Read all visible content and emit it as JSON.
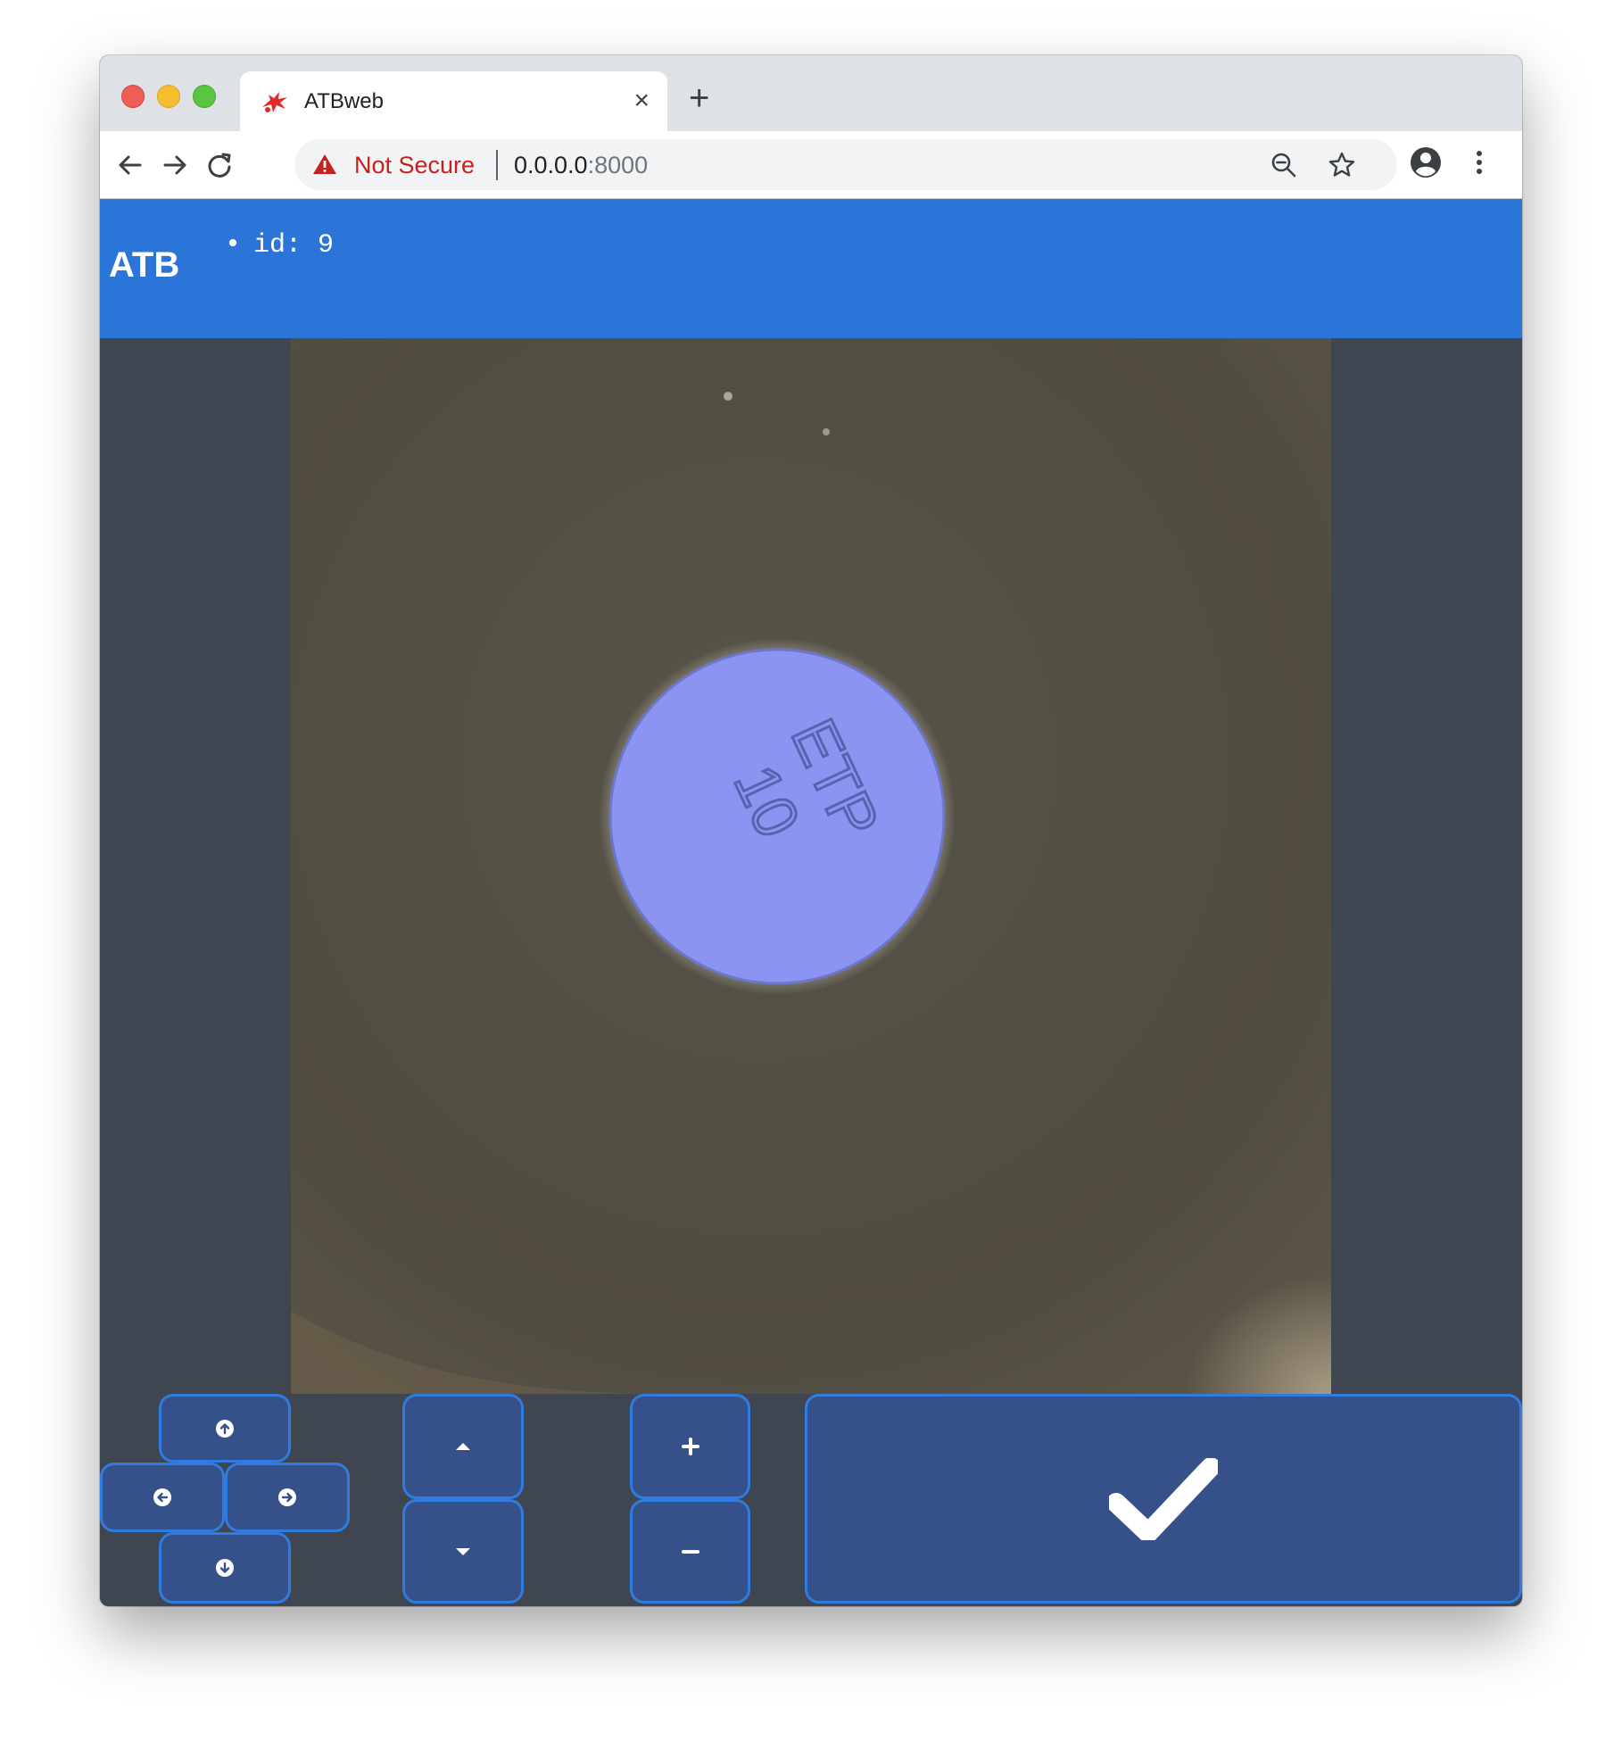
{
  "browser": {
    "tab_title": "ATBweb",
    "tab_close": "×",
    "new_tab": "+",
    "security_label": "Not Secure",
    "url_host": "0.0.0.0",
    "url_port": ":8000"
  },
  "app": {
    "brand": "ATB",
    "id_bullet": "•",
    "id_text": "id: 9"
  },
  "image": {
    "disk_label_line1": "ETP",
    "disk_label_line2": "10",
    "overlay_color": "#8c94f2"
  },
  "controls": {
    "move_up": "arrow-circle-up-icon",
    "move_left": "arrow-circle-left-icon",
    "move_right": "arrow-circle-right-icon",
    "move_down": "arrow-circle-down-icon",
    "step_up": "caret-up-icon",
    "step_down": "caret-down-icon",
    "zoom_in": "plus-icon",
    "zoom_out": "minus-icon",
    "confirm": "checkmark-icon"
  },
  "colors": {
    "header_bg": "#2b75d9",
    "panel_bg": "#3f4650",
    "button_bg": "#36508a",
    "button_border": "#2f7be0",
    "warning_red": "#c5221f"
  }
}
